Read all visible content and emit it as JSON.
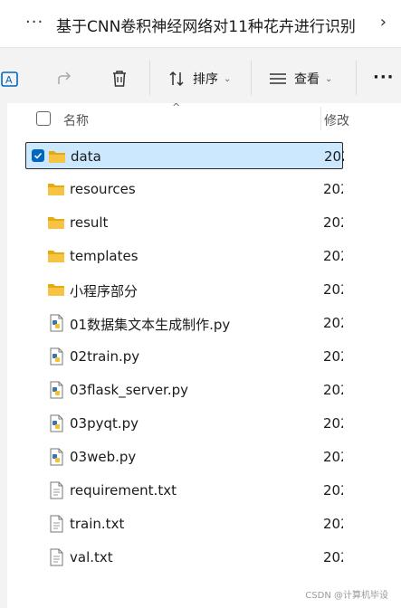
{
  "titlebar": {
    "title": "基于CNN卷积神经网络对11种花卉进行识别",
    "more": "···",
    "next": "›"
  },
  "toolbar": {
    "sort_label": "排序",
    "view_label": "查看",
    "more": "···",
    "caret": "⌄"
  },
  "header": {
    "name_label": "名称",
    "modified_label": "修改",
    "sort_indicator": "^"
  },
  "files": [
    {
      "name": "data",
      "type": "folder",
      "date": "202",
      "selected": true
    },
    {
      "name": "resources",
      "type": "folder",
      "date": "202"
    },
    {
      "name": "result",
      "type": "folder",
      "date": "202"
    },
    {
      "name": "templates",
      "type": "folder",
      "date": "202"
    },
    {
      "name": "小程序部分",
      "type": "folder",
      "date": "202"
    },
    {
      "name": "01数据集文本生成制作.py",
      "type": "py",
      "date": "202"
    },
    {
      "name": "02train.py",
      "type": "py",
      "date": "202"
    },
    {
      "name": "03flask_server.py",
      "type": "py",
      "date": "202"
    },
    {
      "name": "03pyqt.py",
      "type": "py",
      "date": "202"
    },
    {
      "name": "03web.py",
      "type": "py",
      "date": "202"
    },
    {
      "name": "requirement.txt",
      "type": "txt",
      "date": "202"
    },
    {
      "name": "train.txt",
      "type": "txt",
      "date": "202"
    },
    {
      "name": "val.txt",
      "type": "txt",
      "date": "202"
    }
  ],
  "watermark": "CSDN @计算机毕设",
  "colors": {
    "accent": "#0067c0",
    "selection": "#cce8ff",
    "folder": "#f6c342"
  }
}
